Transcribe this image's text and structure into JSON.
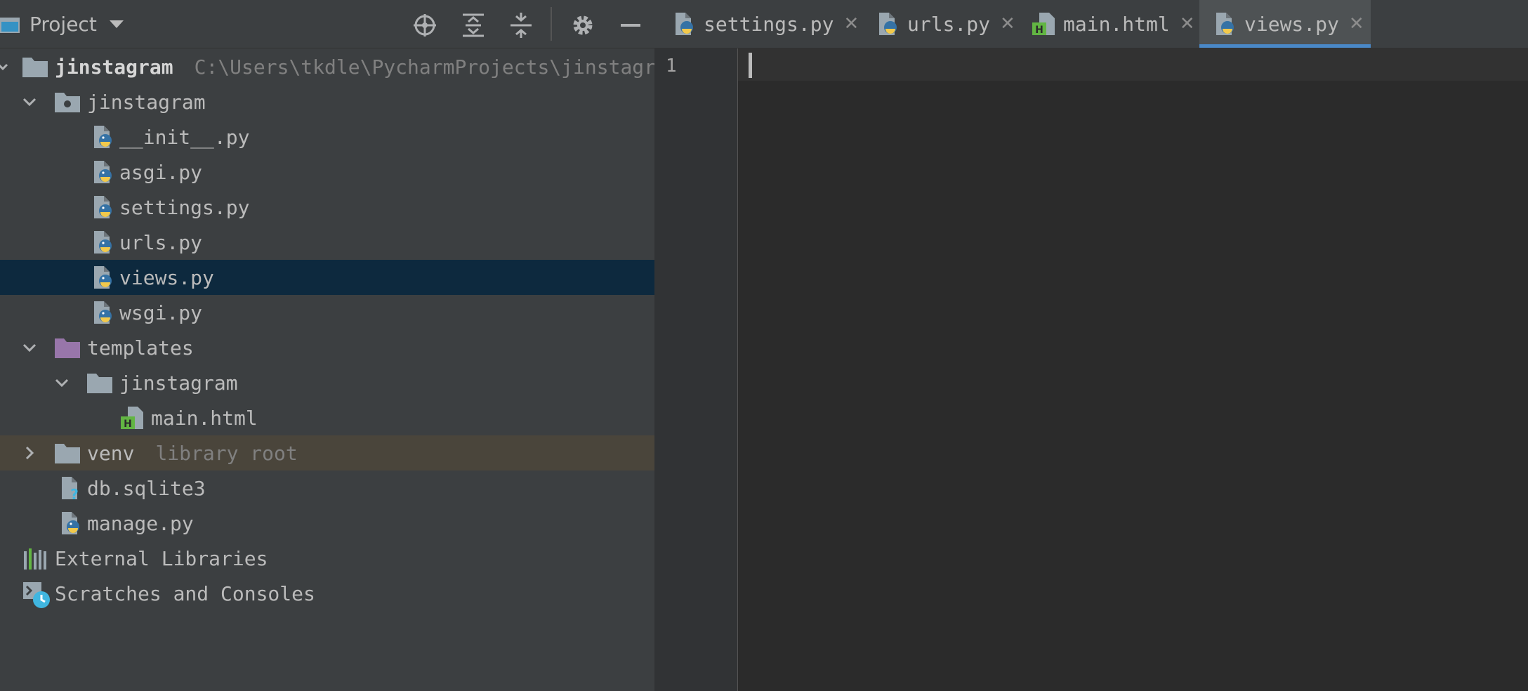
{
  "panel": {
    "title": "Project"
  },
  "tree": {
    "root": {
      "name": "jinstagram",
      "path": "C:\\Users\\tkdle\\PycharmProjects\\jinstagram"
    },
    "pkg": "jinstagram",
    "files": [
      "__init__.py",
      "asgi.py",
      "settings.py",
      "urls.py",
      "views.py",
      "wsgi.py"
    ],
    "templates": "templates",
    "templates_sub": "jinstagram",
    "main_html": "main.html",
    "venv": {
      "name": "venv",
      "hint": "library root"
    },
    "db": "db.sqlite3",
    "manage": "manage.py",
    "external": "External Libraries",
    "scratches": "Scratches and Consoles"
  },
  "tabs": [
    "settings.py",
    "urls.py",
    "main.html",
    "views.py"
  ],
  "active_tab": "views.py",
  "editor": {
    "line_numbers": [
      "1"
    ]
  },
  "colors": {
    "panel_bg": "#3c3f41",
    "editor_bg": "#2b2b2b",
    "selection": "#0d293e",
    "library_root": "#4a453b",
    "active_tab_underline": "#4a88c7"
  }
}
